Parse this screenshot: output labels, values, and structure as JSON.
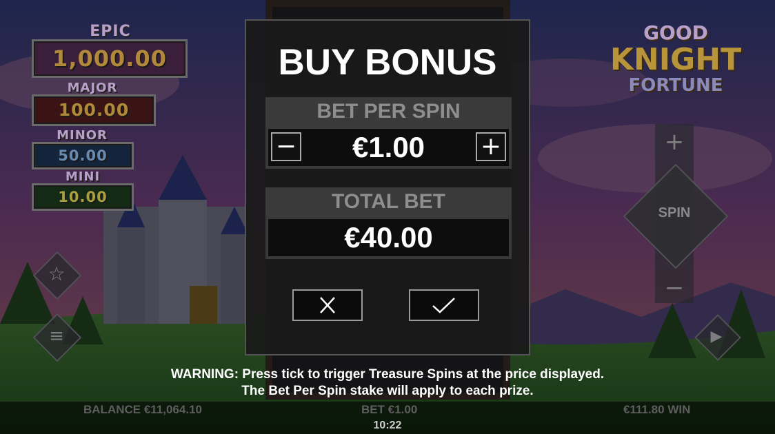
{
  "jackpots": {
    "epic": {
      "label": "EPIC",
      "value": "1,000.00"
    },
    "major": {
      "label": "MAJOR",
      "value": "100.00"
    },
    "minor": {
      "label": "MINOR",
      "value": "50.00"
    },
    "mini": {
      "label": "MINI",
      "value": "10.00"
    }
  },
  "logo": {
    "line1": "GOOD",
    "line2": "KNIGHT",
    "line3": "FORTUNE"
  },
  "controls": {
    "spin_label": "SPIN",
    "plus_symbol": "+",
    "minus_symbol": "−"
  },
  "modal": {
    "title": "BUY BONUS",
    "bet_per_spin_label": "BET PER SPIN",
    "bet_per_spin_value": "€1.00",
    "decrease_symbol": "−",
    "increase_symbol": "+",
    "total_bet_label": "TOTAL BET",
    "total_bet_value": "€40.00"
  },
  "warning": {
    "line1": "WARNING: Press tick to trigger Treasure Spins at the price displayed.",
    "line2": "The Bet Per Spin stake will apply to each prize."
  },
  "bottom_bar": {
    "balance_label": "BALANCE",
    "balance_value": "€11,064.10",
    "bet_label": "BET",
    "bet_value": "€1.00",
    "win_value": "€111.80",
    "win_label": "WIN",
    "clock": "10:22"
  },
  "colors": {
    "epic_text": "#c59a3a",
    "major_text": "#d8a038",
    "minor_text": "#5a8ab8",
    "mini_text": "#d6b836",
    "logo_gold": "#e1b84a",
    "logo_purple": "#a9a6d6"
  }
}
